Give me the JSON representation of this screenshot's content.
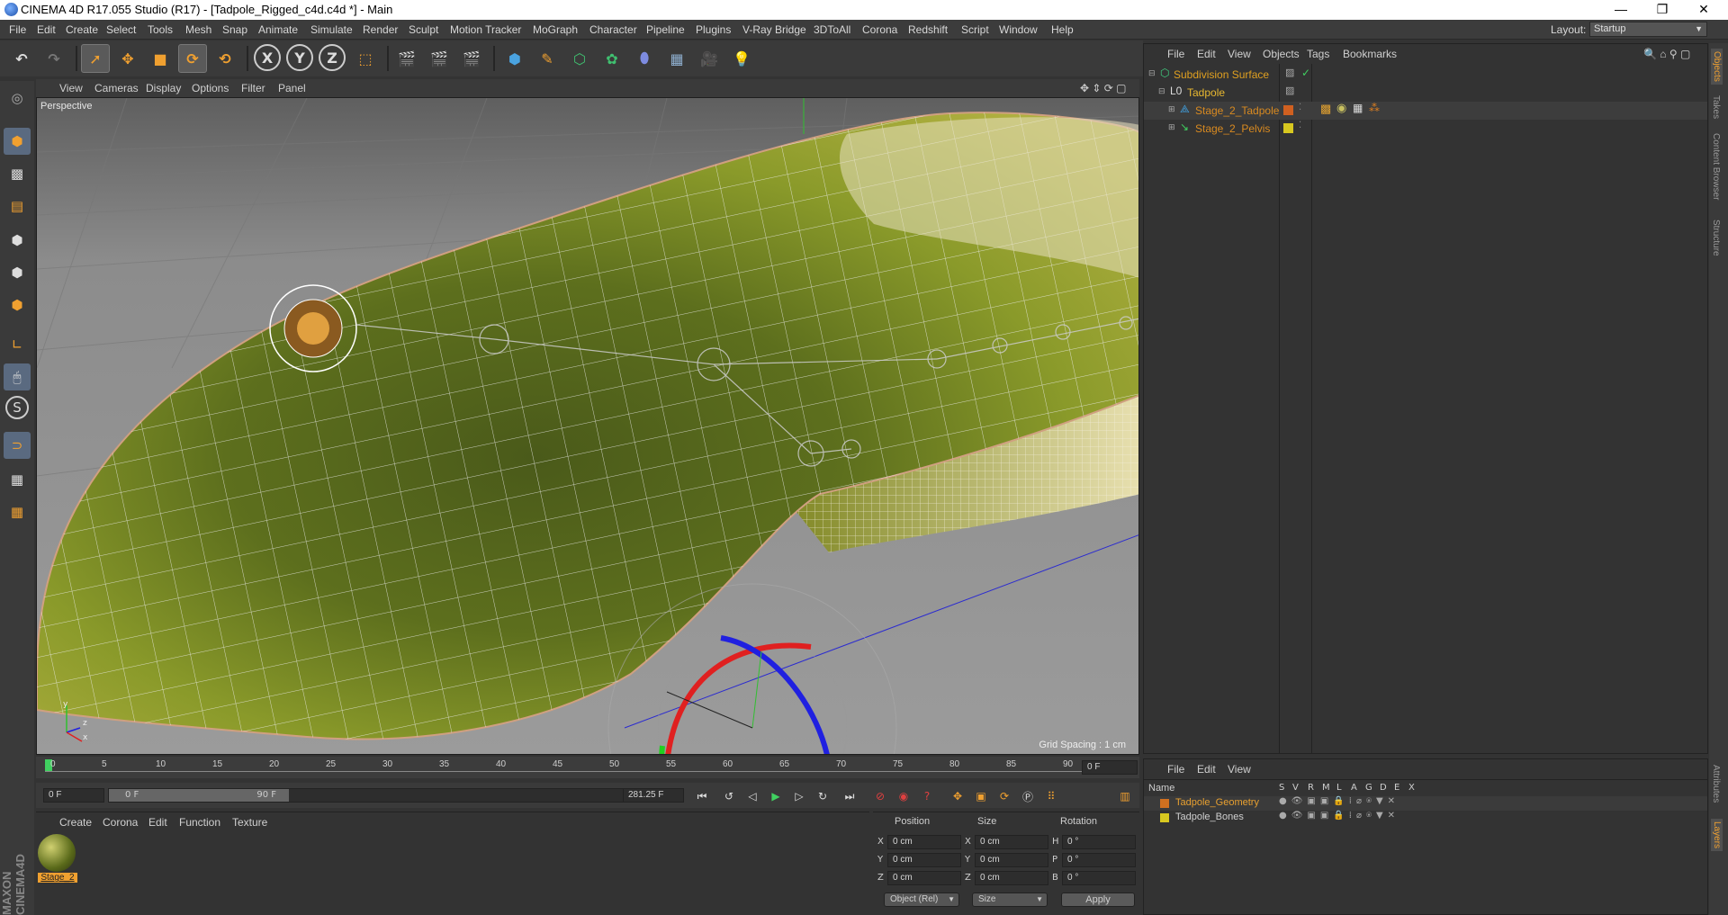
{
  "window": {
    "title": "CINEMA 4D R17.055 Studio (R17) - [Tadpole_Rigged_c4d.c4d *] - Main",
    "controls": [
      "—",
      "❐",
      "✕"
    ]
  },
  "menubar": {
    "items": [
      "File",
      "Edit",
      "Create",
      "Select",
      "Tools",
      "Mesh",
      "Snap",
      "Animate",
      "Simulate",
      "Render",
      "Sculpt",
      "Motion Tracker",
      "MoGraph",
      "Character",
      "Pipeline",
      "Plugins",
      "V-Ray Bridge",
      "3DToAll",
      "Corona",
      "Redshift",
      "Script",
      "Window",
      "Help"
    ],
    "layout_label": "Layout:",
    "layout_value": "Startup"
  },
  "toolbar": {
    "axis_x": "X",
    "axis_y": "Y",
    "axis_z": "Z"
  },
  "viewport": {
    "menu": [
      "View",
      "Cameras",
      "Display",
      "Options",
      "Filter",
      "Panel"
    ],
    "label": "Perspective",
    "grid_spacing": "Grid Spacing : 1 cm",
    "axis_y": "y",
    "axis_z": "z",
    "axis_x": "x"
  },
  "timeline": {
    "ticks": [
      "0",
      "5",
      "10",
      "15",
      "20",
      "25",
      "30",
      "35",
      "40",
      "45",
      "50",
      "55",
      "60",
      "65",
      "70",
      "75",
      "80",
      "85",
      "90"
    ],
    "current_frame": "0 F"
  },
  "transport": {
    "start_field": "0 F",
    "range_start": "0 F",
    "range_end": "90 F",
    "fps_field": "281.25 F"
  },
  "material_panel": {
    "menu": [
      "Create",
      "Corona",
      "Edit",
      "Function",
      "Texture"
    ],
    "material_name": "Stage_2"
  },
  "coordinates": {
    "headers": [
      "Position",
      "Size",
      "Rotation"
    ],
    "rows": [
      {
        "pos_axis": "X",
        "pos": "0 cm",
        "size_axis": "X",
        "size": "0 cm",
        "rot_axis": "H",
        "rot": "0 °"
      },
      {
        "pos_axis": "Y",
        "pos": "0 cm",
        "size_axis": "Y",
        "size": "0 cm",
        "rot_axis": "P",
        "rot": "0 °"
      },
      {
        "pos_axis": "Z",
        "pos": "0 cm",
        "size_axis": "Z",
        "size": "0 cm",
        "rot_axis": "B",
        "rot": "0 °"
      }
    ],
    "mode_select": "Object (Rel)",
    "size_select": "Size",
    "apply_label": "Apply"
  },
  "object_manager": {
    "menu": [
      "File",
      "Edit",
      "View",
      "Objects",
      "Tags",
      "Bookmarks"
    ],
    "objects": [
      {
        "name": "Subdivision Surface",
        "color": "#e0a020",
        "layer_color": ""
      },
      {
        "name": "Tadpole",
        "color": "#e8b830",
        "layer_color": ""
      },
      {
        "name": "Stage_2_Tadpole",
        "color": "#d98a20",
        "layer_color": "#d06020"
      },
      {
        "name": "Stage_2_Pelvis",
        "color": "#d98a20",
        "layer_color": "#d8c820"
      }
    ]
  },
  "layer_manager": {
    "menu": [
      "File",
      "Edit",
      "View"
    ],
    "columns": [
      "Name",
      "S",
      "V",
      "R",
      "M",
      "L",
      "A",
      "G",
      "D",
      "E",
      "X"
    ],
    "layers": [
      {
        "name": "Tadpole_Geometry",
        "color": "#d07020",
        "text_color": "#e8a030"
      },
      {
        "name": "Tadpole_Bones",
        "color": "#d8c820",
        "text_color": "#cfcfcf"
      }
    ]
  },
  "right_tabs": [
    "Objects",
    "Takes",
    "Content Browser",
    "Structure"
  ],
  "right_tabs_bottom": [
    "Attributes",
    "Layers"
  ]
}
